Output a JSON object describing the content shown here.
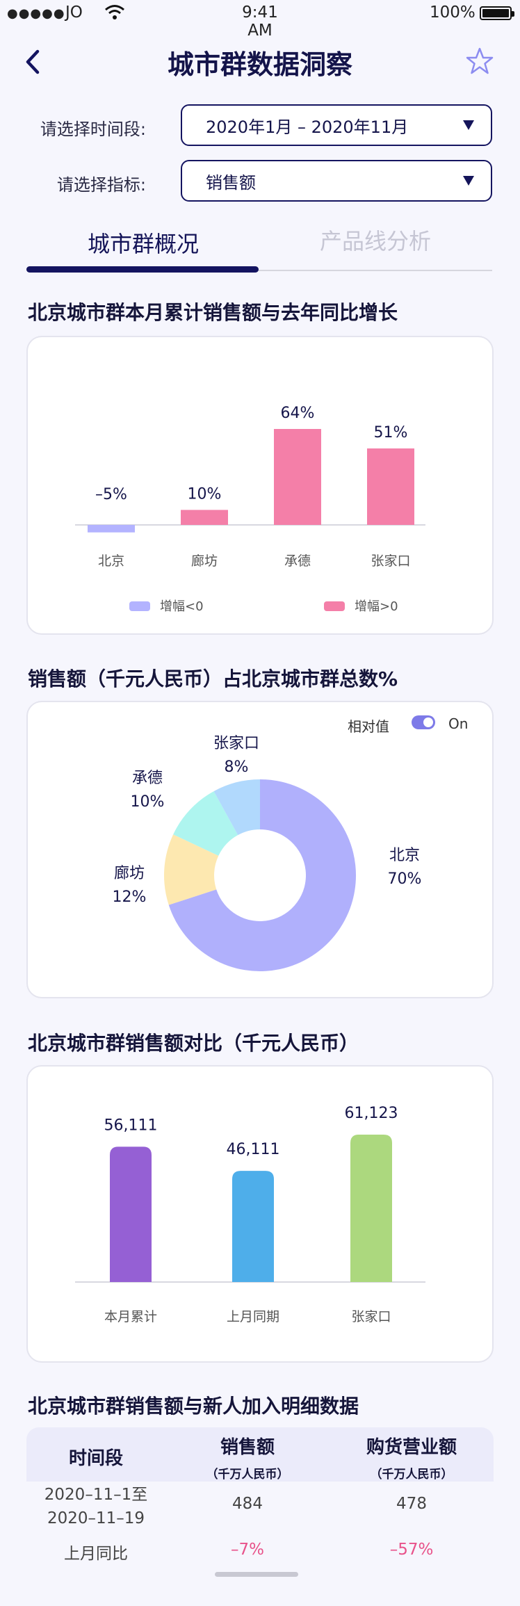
{
  "status_bar": {
    "signal": "●●●●●",
    "carrier": "JO",
    "time": "9:41 AM",
    "battery": "100%"
  },
  "header": {
    "title": "城市群数据洞察"
  },
  "filters": {
    "period_label": "请选择时间段:",
    "period_value": "2020年1月 – 2020年11月",
    "metric_label": "请选择指标:",
    "metric_value": "销售额"
  },
  "tabs": [
    {
      "label": "城市群概况",
      "active": true
    },
    {
      "label": "产品线分析",
      "active": false
    }
  ],
  "section1": {
    "title": "北京城市群本月累计销售额与去年同比增长"
  },
  "section2": {
    "title": "销售额（千元人民币）占北京城市群总数%",
    "toggle_label": "相对值",
    "toggle_state": "On"
  },
  "section3": {
    "title": "北京城市群销售额对比（千元人民币）"
  },
  "section4": {
    "title": "北京城市群销售额与新人加入明细数据",
    "columns": [
      {
        "label": "时间段",
        "sub": ""
      },
      {
        "label": "销售额",
        "sub": "（千万人民币）"
      },
      {
        "label": "购货营业额",
        "sub": "（千万人民币）"
      }
    ],
    "rows": [
      {
        "period": [
          "2020–11–1至",
          "2020–11–19"
        ],
        "sales": "484",
        "turnover": "478"
      },
      {
        "period": [
          "上月同比"
        ],
        "sales": "–7%",
        "turnover": "–57%"
      }
    ]
  },
  "chart_data": [
    {
      "type": "bar",
      "categories": [
        "北京",
        "廊坊",
        "承德",
        "张家口"
      ],
      "values": [
        -5,
        10,
        64,
        51
      ],
      "value_labels": [
        "–5%",
        "10%",
        "64%",
        "51%"
      ],
      "legend": [
        {
          "label": "增幅<0",
          "color": "#b3b3ff"
        },
        {
          "label": "增幅>0",
          "color": "#f47fa8"
        }
      ],
      "colors": {
        "negative": "#b3b3ff",
        "positive": "#f47fa8"
      }
    },
    {
      "type": "pie",
      "labels": [
        "北京",
        "廊坊",
        "承德",
        "张家口"
      ],
      "values": [
        70,
        12,
        10,
        8
      ],
      "value_labels": [
        "70%",
        "12%",
        "10%",
        "8%"
      ],
      "colors": [
        "#b0b0fc",
        "#fde8b0",
        "#aef5ef",
        "#b1d9fd"
      ]
    },
    {
      "type": "bar",
      "categories": [
        "本月累计",
        "上月同期",
        "张家口"
      ],
      "values": [
        56111,
        46111,
        61123
      ],
      "value_labels": [
        "56,111",
        "46,111",
        "61,123"
      ],
      "colors": [
        "#9560d4",
        "#4eaeea",
        "#acd87e"
      ]
    }
  ]
}
